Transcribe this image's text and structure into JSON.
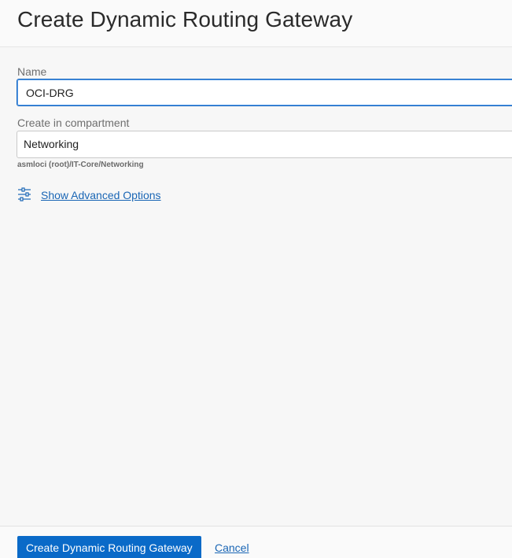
{
  "header": {
    "title": "Create Dynamic Routing Gateway"
  },
  "form": {
    "name": {
      "label": "Name",
      "value": "OCI-DRG"
    },
    "compartment": {
      "label": "Create in compartment",
      "selected": "Networking",
      "path": "asmloci (root)/IT-Core/Networking"
    },
    "advanced": {
      "label": "Show Advanced Options",
      "icon": "sliders-icon"
    }
  },
  "footer": {
    "submit_label": "Create Dynamic Routing Gateway",
    "cancel_label": "Cancel"
  },
  "colors": {
    "accent": "#0a6ac8",
    "link": "#1a66b5",
    "focus_border": "#1565c0"
  }
}
